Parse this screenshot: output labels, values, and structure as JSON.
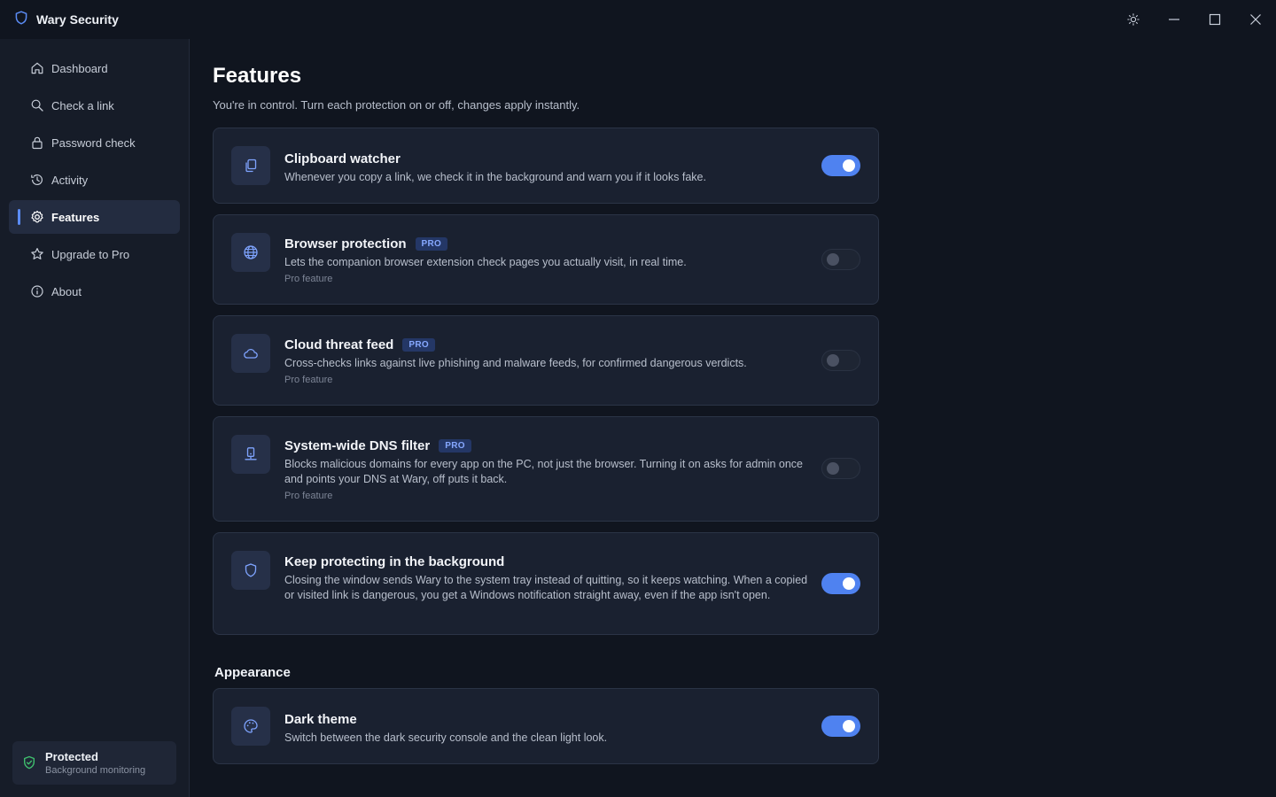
{
  "window": {
    "title": "Wary Security",
    "accent": "#5b8cf5",
    "controls": [
      "theme-toggle",
      "minimize",
      "maximize",
      "close"
    ]
  },
  "sidebar": {
    "items": [
      {
        "label": "Dashboard",
        "icon": "home-icon",
        "active": false
      },
      {
        "label": "Check a link",
        "icon": "search-icon",
        "active": false
      },
      {
        "label": "Password check",
        "icon": "lock-icon",
        "active": false
      },
      {
        "label": "Activity",
        "icon": "history-icon",
        "active": false
      },
      {
        "label": "Features",
        "icon": "gear-icon",
        "active": true
      },
      {
        "label": "Upgrade to Pro",
        "icon": "star-icon",
        "active": false
      },
      {
        "label": "About",
        "icon": "info-icon",
        "active": false
      }
    ],
    "status": {
      "title": "Protected",
      "subtitle": "Background monitoring",
      "color": "#3fbf6e"
    }
  },
  "main": {
    "title": "Features",
    "subtitle": "You're in control. Turn each protection on or off, changes apply instantly.",
    "features": [
      {
        "title": "Clipboard watcher",
        "pro": false,
        "desc": "Whenever you copy a link, we check it in the background and warn you if it looks fake.",
        "note": "",
        "enabled": true,
        "icon": "clipboard-icon"
      },
      {
        "title": "Browser protection",
        "pro": true,
        "badge": "PRO",
        "desc": "Lets the companion browser extension check pages you actually visit, in real time.",
        "note": "Pro feature",
        "enabled": false,
        "icon": "globe-icon"
      },
      {
        "title": "Cloud threat feed",
        "pro": true,
        "badge": "PRO",
        "desc": "Cross-checks links against live phishing and malware feeds, for confirmed dangerous verdicts.",
        "note": "Pro feature",
        "enabled": false,
        "icon": "cloud-icon"
      },
      {
        "title": "System-wide DNS filter",
        "pro": true,
        "badge": "PRO",
        "desc": "Blocks malicious domains for every app on the PC, not just the browser. Turning it on asks for admin once and points your DNS at Wary, off puts it back.",
        "note": "Pro feature",
        "enabled": false,
        "icon": "dns-icon"
      },
      {
        "title": "Keep protecting in the background",
        "pro": false,
        "desc": "Closing the window sends Wary to the system tray instead of quitting, so it keeps watching. When a copied or visited link is dangerous, you get a Windows notification straight away, even if the app isn't open.",
        "note": "",
        "enabled": true,
        "icon": "shield-icon"
      }
    ],
    "appearance": {
      "heading": "Appearance",
      "item": {
        "title": "Dark theme",
        "desc": "Switch between the dark security console and the clean light look.",
        "enabled": true,
        "icon": "palette-icon"
      }
    }
  }
}
